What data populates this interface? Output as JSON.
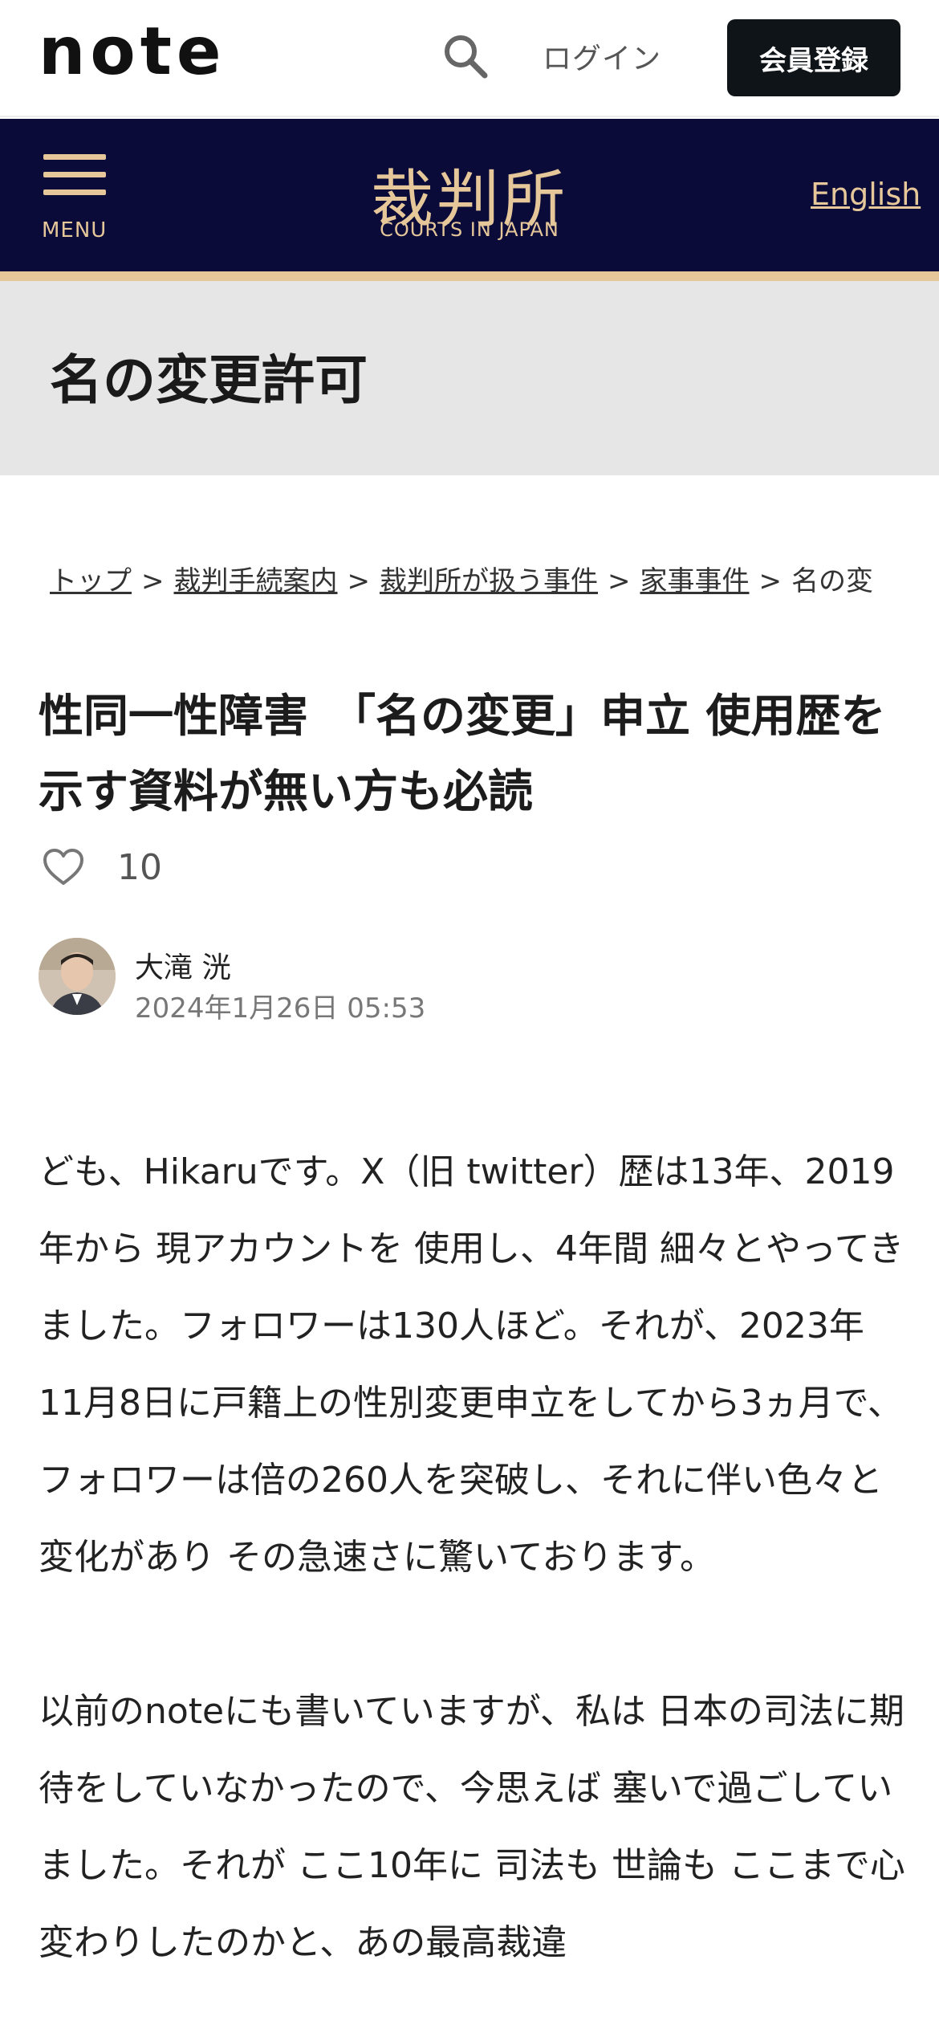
{
  "header": {
    "logo_text": "note",
    "search_icon": "search-icon",
    "login_label": "ログイン",
    "signup_label": "会員登録"
  },
  "courts_banner": {
    "menu_label": "MENU",
    "title": "裁判所",
    "subtitle": "COURTS IN JAPAN",
    "english_link": "English",
    "accent_color": "#e6c79a",
    "background_color": "#0b0b3a"
  },
  "page_band": {
    "title": "名の変更許可"
  },
  "breadcrumb": {
    "items": [
      "トップ",
      "裁判手続案内",
      "裁判所が扱う事件",
      "家事事件"
    ],
    "current": "名の変",
    "separator": ">"
  },
  "article": {
    "title": "性同一性障害　「名の変更」申立 使用歴を示す資料が無い方も必読",
    "like_count": "10",
    "author_name": "大滝 洸",
    "published": "2024年1月26日 05:53",
    "paragraphs": [
      "ども、Hikaruです。X（旧 twitter）歴は13年、2019年から 現アカウントを 使用し、4年間 細々とやってきました。フォロワーは130人ほど。それが、2023年11月8日に戸籍上の性別変更申立をしてから3ヵ月で、フォロワーは倍の260人を突破し、それに伴い色々と変化があり その急速さに驚いております。",
      "以前のnoteにも書いていますが、私は 日本の司法に期待をしていなかったので、今思えば 塞いで過ごしていました。それが ここ10年に 司法も 世論も ここまで心変わりしたのかと、あの最高裁違"
    ]
  }
}
